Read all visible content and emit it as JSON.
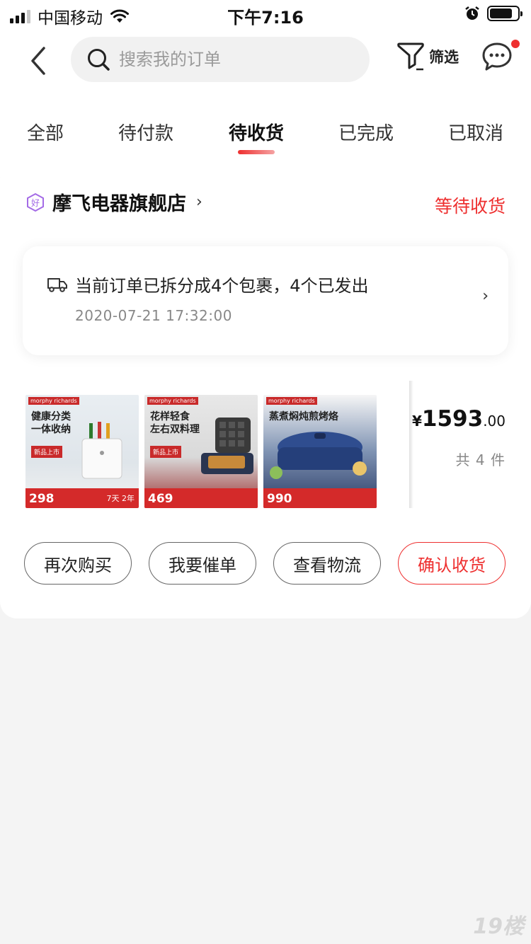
{
  "status_bar": {
    "carrier": "中国移动",
    "time": "下午7:16"
  },
  "header": {
    "search_placeholder": "搜索我的订单",
    "filter_label": "筛选",
    "has_unread_messages": true
  },
  "tabs": [
    {
      "label": "全部",
      "active": false
    },
    {
      "label": "待付款",
      "active": false
    },
    {
      "label": "待收货",
      "active": true
    },
    {
      "label": "已完成",
      "active": false
    },
    {
      "label": "已取消",
      "active": false
    }
  ],
  "order": {
    "shop_badge": "好",
    "shop_name": "摩飞电器旗舰店",
    "status": "等待收货",
    "package_summary": "当前订单已拆分成4个包裹，4个已发出",
    "package_time": "2020-07-21 17:32:00",
    "products": [
      {
        "brand": "morphy richards",
        "title": "健康分类\n一体收纳",
        "tag": "新品上市",
        "price": "298",
        "extra": "7天 2年"
      },
      {
        "brand": "morphy richards",
        "title": "花样轻食\n左右双料理",
        "tag": "新品上市",
        "price": "469",
        "extra": ""
      },
      {
        "brand": "morphy richards",
        "title": "蒸煮焖炖煎烤烙",
        "tag": "",
        "price": "990",
        "extra": ""
      }
    ],
    "price_currency": "¥",
    "price_int": "1593",
    "price_dec": ".00",
    "item_count": "共 4 件",
    "actions": [
      {
        "label": "再次购买",
        "primary": false
      },
      {
        "label": "我要催单",
        "primary": false
      },
      {
        "label": "查看物流",
        "primary": false
      },
      {
        "label": "确认收货",
        "primary": true
      }
    ]
  },
  "colors": {
    "accent": "#ee2f2f",
    "background": "#f4f4f4",
    "card": "#ffffff",
    "muted_text": "#888888"
  },
  "icons": {
    "back": "chevron-left-icon",
    "search": "search-icon",
    "filter": "filter-icon",
    "message": "chat-bubble-icon",
    "shop": "good-shop-badge-icon",
    "package": "truck-icon"
  },
  "watermark": "19楼"
}
